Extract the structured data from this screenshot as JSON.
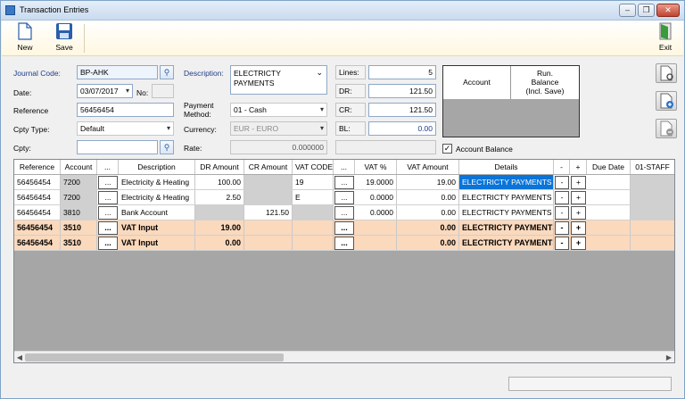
{
  "window": {
    "title": "Transaction Entries"
  },
  "toolbar": {
    "new_label": "New",
    "save_label": "Save",
    "exit_label": "Exit"
  },
  "form": {
    "journal_code_label": "Journal Code:",
    "journal_code": "BP-AHK",
    "date_label": "Date:",
    "date": "03/07/2017",
    "no_label": "No:",
    "no_value": "",
    "reference_label": "Reference",
    "reference": "56456454",
    "cpty_type_label": "Cpty Type:",
    "cpty_type": "Default",
    "cpty_label": "Cpty:",
    "cpty": "",
    "description_label": "Description:",
    "description_line1": "ELECTRICTY",
    "description_line2": "PAYMENTS",
    "payment_method_label_1": "Payment",
    "payment_method_label_2": "Method:",
    "payment_method": "01 - Cash",
    "currency_label": "Currency:",
    "currency": "EUR - EURO",
    "rate_label": "Rate:",
    "rate": "0.000000",
    "lines_label": "Lines:",
    "lines": "5",
    "dr_label": "DR:",
    "dr": "121.50",
    "cr_label": "CR:",
    "cr": "121.50",
    "bl_label": "BL:",
    "bl": "0.00"
  },
  "balance_panel": {
    "col_account": "Account",
    "col_run_1": "Run.",
    "col_run_2": "Balance",
    "col_run_3": "(Incl. Save)"
  },
  "account_balance": {
    "label": "Account Balance",
    "checked": true,
    "mark": "✓"
  },
  "grid": {
    "headers": [
      "Reference",
      "Account",
      "...",
      "Description",
      "DR Amount",
      "CR Amount",
      "VAT CODE",
      "...",
      "VAT %",
      "VAT Amount",
      "Details",
      "-",
      "+",
      "Due Date",
      "01-STAFF"
    ],
    "rows": [
      {
        "ref": "56456454",
        "account": "7200",
        "dots": "...",
        "desc": "Electricity & Heating",
        "dr": "100.00",
        "cr": "",
        "vat_code": "19",
        "dots2": "...",
        "vat_pct": "19.0000",
        "vat_amt": "19.00",
        "details": "ELECTRICTY PAYMENTS",
        "minus": "-",
        "plus": "+",
        "due": "",
        "staff": ""
      },
      {
        "ref": "56456454",
        "account": "7200",
        "dots": "...",
        "desc": "Electricity & Heating",
        "dr": "2.50",
        "cr": "",
        "vat_code": "E",
        "dots2": "...",
        "vat_pct": "0.0000",
        "vat_amt": "0.00",
        "details": "ELECTRICTY PAYMENTS",
        "minus": "-",
        "plus": "+",
        "due": "",
        "staff": ""
      },
      {
        "ref": "56456454",
        "account": "3810",
        "dots": "...",
        "desc": "Bank Account",
        "dr": "",
        "cr": "121.50",
        "vat_code": "",
        "dots2": "...",
        "vat_pct": "0.0000",
        "vat_amt": "0.00",
        "details": "ELECTRICTY PAYMENTS",
        "minus": "-",
        "plus": "+",
        "due": "",
        "staff": ""
      },
      {
        "ref": "56456454",
        "account": "3510",
        "dots": "...",
        "desc": "VAT Input",
        "dr": "19.00",
        "cr": "",
        "vat_code": "",
        "dots2": "...",
        "vat_pct": "",
        "vat_amt": "0.00",
        "details": "ELECTRICTY PAYMENTS",
        "minus": "-",
        "plus": "+",
        "due": "",
        "staff": ""
      },
      {
        "ref": "56456454",
        "account": "3510",
        "dots": "...",
        "desc": "VAT Input",
        "dr": "0.00",
        "cr": "",
        "vat_code": "",
        "dots2": "...",
        "vat_pct": "",
        "vat_amt": "0.00",
        "details": "ELECTRICTY PAYMENTS",
        "minus": "-",
        "plus": "+",
        "due": "",
        "staff": ""
      }
    ]
  },
  "colors": {
    "accent_blue": "#1f3d8c",
    "selection": "#0a74d9",
    "summary_row": "#fbd9bd",
    "toolbar_bg": "#fff7e0"
  }
}
